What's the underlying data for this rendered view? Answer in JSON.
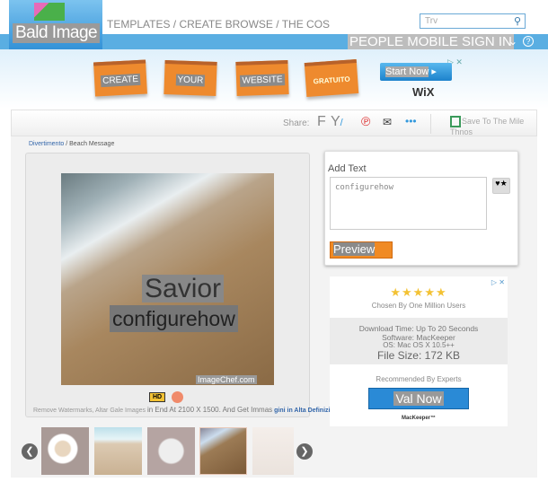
{
  "header": {
    "logo_text": "Bald Image",
    "nav": "TEMPLATES / CREATE BROWSE / THE COS",
    "search_placeholder": "Trv",
    "account": "PEOPLE MOBILE SIGN IN",
    "help": "?"
  },
  "banner": {
    "cards": [
      "CREATE",
      "YOUR",
      "WEBSITE",
      "GRATUITO"
    ],
    "cta": "Start Now",
    "brand": "WiX",
    "ad_marker": "▷ ✕"
  },
  "toolbar": {
    "share_label": "Share:",
    "share_icons": [
      "facebook-icon",
      "twitter-icon",
      "pinterest-icon",
      "email-icon",
      "more-icon"
    ],
    "save_label": "Save To The Mile Thnos"
  },
  "breadcrumb": {
    "parent": "Divertimento",
    "current": "/ Beach Message"
  },
  "image": {
    "line1": "Savior",
    "line2": "configurehow",
    "watermark": "ImageChef.com"
  },
  "hd": {
    "badge": "HD",
    "note": "Remove Watermarks, Altar Gale Images",
    "resolution": "in End At 2100 X 1500. And Get Immas",
    "link": "gini in Alta Definizione"
  },
  "editor": {
    "label": "Add Text",
    "value": "configurehow",
    "symbols": "♥★",
    "preview": "Preview"
  },
  "ad": {
    "stars": "★★★★★",
    "chosen": "Chosen By One Million Users",
    "download": "Download Time: Up To 20 Seconds",
    "software": "Software: MacKeeper",
    "os": "OS: Mac OS X 10.5++",
    "size": "File Size: 172 KB",
    "recommended": "Recommended By Experts",
    "cta": "Val Now",
    "brand": "MacKeeper™",
    "marker": "▷ ✕"
  },
  "thumbs": [
    "coffee",
    "sand-writing",
    "message-card",
    "beach-your-text",
    "thank-you"
  ]
}
